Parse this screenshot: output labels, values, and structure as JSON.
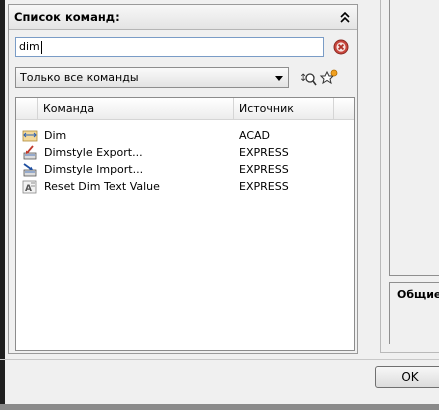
{
  "panel": {
    "title": "Список команд:",
    "search_value": "dim",
    "filter_selected": "Только все команды"
  },
  "list": {
    "columns": [
      "Команда",
      "Источник"
    ],
    "rows": [
      {
        "name": "Dim",
        "source": "ACAD",
        "icon": "dimension-icon"
      },
      {
        "name": "Dimstyle Export...",
        "source": "EXPRESS",
        "icon": "dimstyle-export-icon"
      },
      {
        "name": "Dimstyle Import...",
        "source": "EXPRESS",
        "icon": "dimstyle-import-icon"
      },
      {
        "name": "Reset Dim Text Value",
        "source": "EXPRESS",
        "icon": "reset-dim-text-icon"
      }
    ]
  },
  "right_panel": {
    "label": "Общие"
  },
  "buttons": {
    "ok": "OK"
  }
}
